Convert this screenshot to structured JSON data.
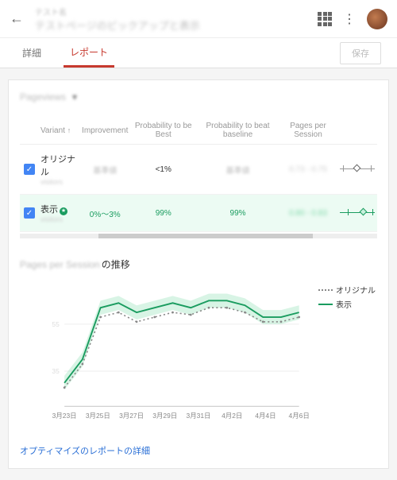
{
  "header": {
    "title_small": "テスト名",
    "title_main": "テストページのピックアップと表示",
    "tabs": {
      "details": "詳細",
      "report": "レポート"
    },
    "save": "保存"
  },
  "metric": {
    "label": "Pageviews"
  },
  "table": {
    "cols": {
      "variant": "Variant",
      "improvement": "Improvement",
      "ptb": "Probability to be Best",
      "pbb": "Probability to beat baseline",
      "pps": "Pages per Session"
    },
    "rows": [
      {
        "name": "オリジナル",
        "sub": "visitors",
        "improvement": "基準値",
        "ptb": "<1%",
        "pbb": "基準値",
        "pps": "0.73 - 0.75",
        "is_winner": false
      },
      {
        "name": "表示",
        "sub": "visitors",
        "improvement": "0%～3%",
        "ptb": "99%",
        "pbb": "99%",
        "pps": "0.80 - 0.83",
        "is_winner": true
      }
    ]
  },
  "chart": {
    "title_blur": "Pages per Session",
    "title_suffix": "の推移",
    "legend": {
      "original": "オリジナル",
      "variant": "表示"
    }
  },
  "chart_data": {
    "type": "line",
    "categories": [
      "3月23日",
      "3月25日",
      "3月27日",
      "3月29日",
      "3月31日",
      "4月2日",
      "4月4日",
      "4月6日"
    ],
    "series": [
      {
        "name": "オリジナル",
        "values": [
          28,
          38,
          58,
          60,
          56,
          58,
          60,
          59,
          62,
          62,
          60,
          56,
          56,
          58
        ]
      },
      {
        "name": "表示",
        "values": [
          30,
          40,
          62,
          64,
          60,
          62,
          64,
          62,
          65,
          65,
          63,
          58,
          58,
          60
        ]
      }
    ],
    "ylim": [
      20,
      70
    ]
  },
  "footer": {
    "link": "オプティマイズのレポートの詳細"
  }
}
